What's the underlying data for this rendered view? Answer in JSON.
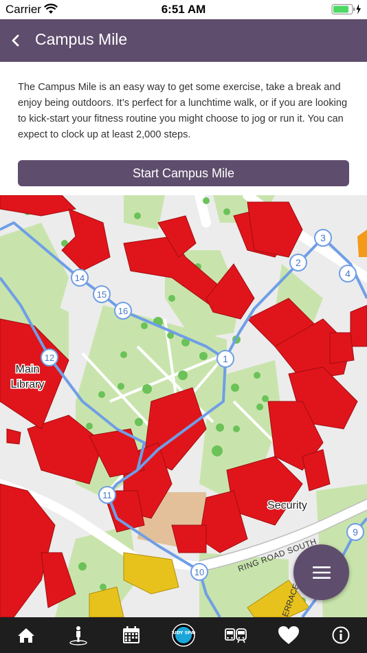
{
  "status_bar": {
    "carrier": "Carrier",
    "time": "6:51 AM"
  },
  "nav": {
    "title": "Campus Mile",
    "back_icon": "chevron-left-icon"
  },
  "intro_text": "The Campus Mile is an easy way to get some exercise, take a break and enjoy being outdoors. It’s perfect for a lunchtime walk, or if you are looking to kick-start your fitness routine you might choose to jog or run it. You can expect to clock up at least 2,000 steps.",
  "start_button": {
    "label": "Start Campus Mile"
  },
  "map": {
    "labels": {
      "library_line1": "Main",
      "library_line2": "Library",
      "security": "Security",
      "road": "RING ROAD SOUTH",
      "terrace": "ERRACE"
    },
    "waypoints": [
      "1",
      "2",
      "3",
      "4",
      "9",
      "10",
      "11",
      "12",
      "14",
      "15",
      "16"
    ],
    "colors": {
      "route": "#6f9ee6",
      "building": "#e0151b",
      "grass": "#c8e4ac",
      "tree": "#6bc258",
      "pavement": "#e6e6e6"
    }
  },
  "fab": {
    "icon": "menu-icon"
  },
  "tab_bar": {
    "icons": [
      "home-icon",
      "person-pin-icon",
      "calendar-icon",
      "study-space-icon",
      "bus-train-icon",
      "heart-icon",
      "info-icon"
    ],
    "study_space_label": "STUDY SPACE"
  }
}
